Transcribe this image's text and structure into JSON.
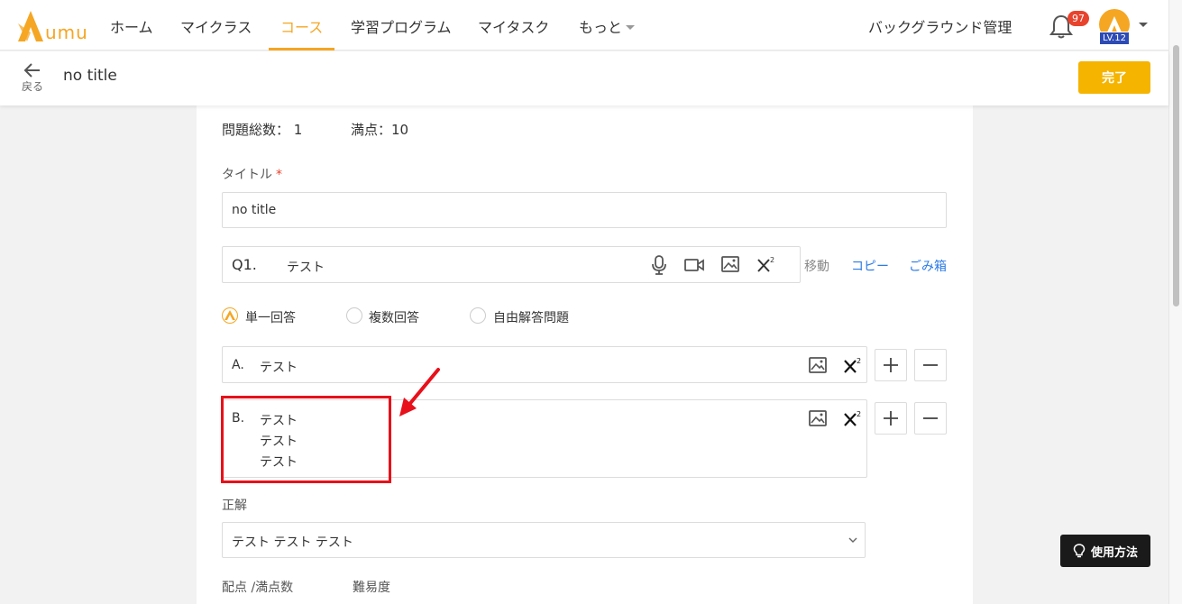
{
  "nav": {
    "logo_text": "umu",
    "items": [
      "ホーム",
      "マイクラス",
      "コース",
      "学習プログラム",
      "マイタスク",
      "もっと"
    ],
    "bg_admin": "バックグラウンド管理",
    "notification_count": "97",
    "level": "LV.12"
  },
  "header": {
    "back_label": "戻る",
    "title": "no title",
    "done_label": "完了"
  },
  "summary": {
    "total_questions": "問題総数： 1",
    "full_score": "満点：10"
  },
  "form": {
    "title_label": "タイトル",
    "title_value": "no title",
    "question_number": "Q1.",
    "question_text": "テスト",
    "move_label": "移動",
    "copy_label": "コピー",
    "trash_label": "ごみ箱",
    "answer_types": [
      "単一回答",
      "複数回答",
      "自由解答問題"
    ],
    "options": [
      {
        "letter": "A.",
        "lines": [
          "テスト"
        ]
      },
      {
        "letter": "B.",
        "lines": [
          "テスト",
          "テスト",
          "テスト"
        ]
      }
    ],
    "correct_label": "正解",
    "correct_value": "テスト テスト テスト",
    "score_label": "配点 /満点数",
    "difficulty_label": "難易度"
  },
  "help": {
    "label": "使用方法"
  },
  "colors": {
    "accent": "#f5a623",
    "link": "#2d7be5",
    "highlight": "#e8101a"
  }
}
